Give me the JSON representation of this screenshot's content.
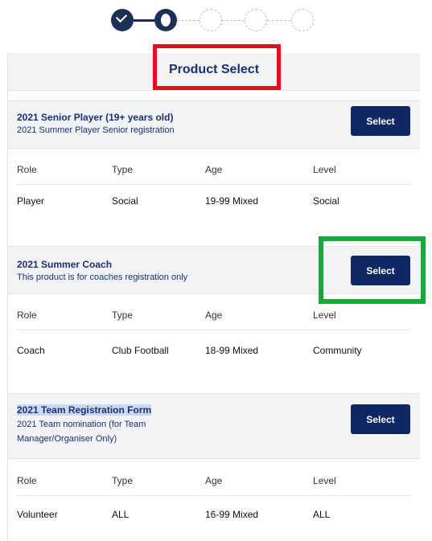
{
  "panel": {
    "title": "Product Select"
  },
  "columns": [
    "Role",
    "Type",
    "Age",
    "Level"
  ],
  "products": [
    {
      "name": "2021 Senior Player (19+ years old)",
      "description": "2021 Summer Player Senior registration",
      "select_label": "Select",
      "role": "Player",
      "type": "Social",
      "age": "19-99 Mixed",
      "level": "Social"
    },
    {
      "name": "2021 Summer Coach",
      "description": "This product is for coaches registration only",
      "select_label": "Select",
      "role": "Coach",
      "type": "Club Football",
      "age": "18-99 Mixed",
      "level": "Community"
    },
    {
      "name": "2021 Team Registration Form",
      "description_line1": "2021 Team nomination (for Team",
      "description_line2": "Manager/Organiser Only)",
      "select_label": "Select",
      "role": "Volunteer",
      "type": "ALL",
      "age": "16-99 Mixed",
      "level": "ALL"
    }
  ],
  "colors": {
    "accent": "#102765",
    "title": "#1c2f6e",
    "highlight_red": "#e0111a",
    "highlight_green": "#1aa83a"
  }
}
